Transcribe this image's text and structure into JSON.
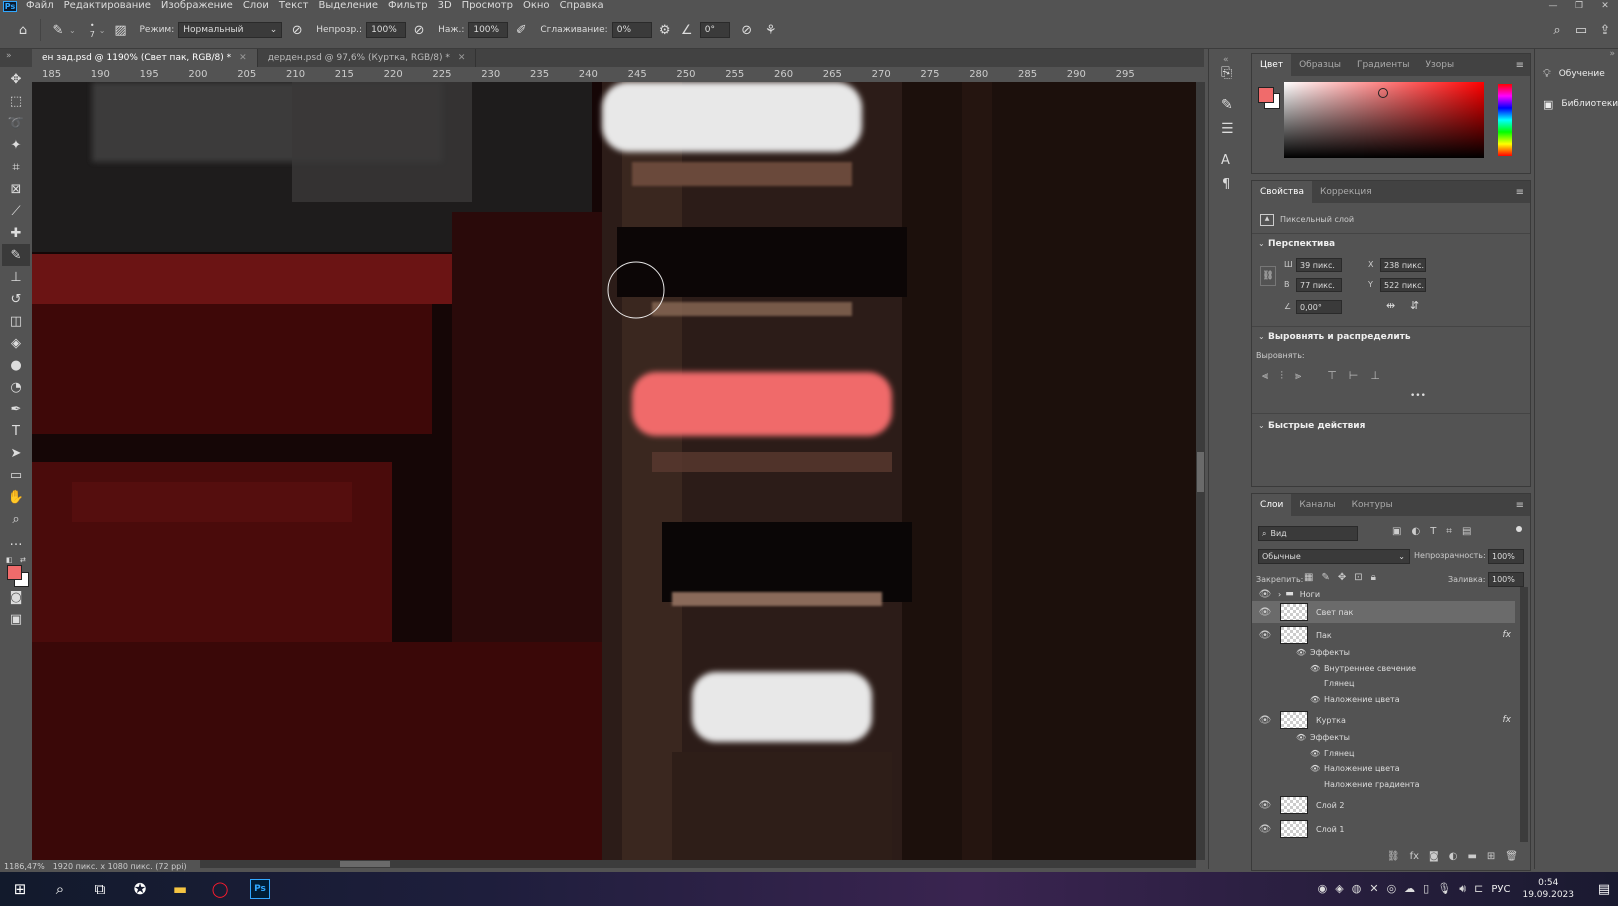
{
  "app": {
    "logo": "Ps"
  },
  "menu": [
    "Файл",
    "Редактирование",
    "Изображение",
    "Слои",
    "Текст",
    "Выделение",
    "Фильтр",
    "3D",
    "Просмотр",
    "Окно",
    "Справка"
  ],
  "window_controls": [
    "—",
    "❐",
    "✕"
  ],
  "options": {
    "mode_label": "Режим:",
    "mode_value": "Нормальный",
    "opacity_label": "Непрозр.:",
    "opacity_value": "100%",
    "pressure_label": "Наж.:",
    "pressure_value": "100%",
    "smoothing_label": "Сглаживание:",
    "smoothing_value": "0%",
    "angle_value": "0°",
    "brush_size": "7"
  },
  "doc_tabs": [
    {
      "label": "ен зад.psd @ 1190% (Свет пак, RGB/8) *",
      "active": true
    },
    {
      "label": "дерден.psd @ 97,6% (Куртка, RGB/8) *",
      "active": false
    }
  ],
  "ruler_ticks": [
    "185",
    "190",
    "195",
    "200",
    "205",
    "210",
    "215",
    "220",
    "225",
    "230",
    "235",
    "240",
    "245",
    "250",
    "255",
    "260",
    "265",
    "270",
    "275",
    "280",
    "285",
    "290",
    "295"
  ],
  "status": {
    "zoom": "1186,47%",
    "doc_info": "1920 пикс. x 1080 пикс. (72 ppi)"
  },
  "color_panel": {
    "tabs": [
      "Цвет",
      "Образцы",
      "Градиенты",
      "Узоры"
    ],
    "foreground": "#f06b6b",
    "background": "#ffffff"
  },
  "properties": {
    "tabs": [
      "Свойства",
      "Коррекция"
    ],
    "layer_type": "Пиксельный слой",
    "section_perspective": "Перспектива",
    "w_label": "Ш",
    "w_value": "39 пикс.",
    "h_label": "В",
    "h_value": "77 пикс.",
    "x_label": "X",
    "x_value": "238 пикс.",
    "y_label": "Y",
    "y_value": "522 пикс.",
    "angle_value": "0,00°",
    "section_align": "Выровнять и распределить",
    "align_label": "Выровнять:",
    "more": "•••",
    "section_quick": "Быстрые действия"
  },
  "layers_panel": {
    "tabs": [
      "Слои",
      "Каналы",
      "Контуры"
    ],
    "filter_placeholder": "Вид",
    "blend_mode": "Обычные",
    "opacity_label": "Непрозрачность:",
    "opacity_value": "100%",
    "lock_label": "Закрепить:",
    "fill_label": "Заливка:",
    "fill_value": "100%",
    "group": "Ноги",
    "layers": [
      {
        "name": "Свет пак",
        "selected": true
      },
      {
        "name": "Пак",
        "fx": "fx"
      },
      {
        "name": "Куртка",
        "fx": "fx"
      },
      {
        "name": "Слой 2"
      },
      {
        "name": "Слой 1"
      }
    ],
    "pak_effects": {
      "title": "Эффекты",
      "items": [
        "Внутреннее свечение",
        "Глянец",
        "Наложение цвета"
      ]
    },
    "kurtka_effects": {
      "title": "Эффекты",
      "items": [
        "Глянец",
        "Наложение цвета",
        "Наложение градиента"
      ]
    }
  },
  "right_dock": {
    "learn": "Обучение",
    "libraries": "Библиотеки"
  },
  "taskbar": {
    "lang": "РУС",
    "time": "0:54",
    "date": "19.09.2023"
  }
}
